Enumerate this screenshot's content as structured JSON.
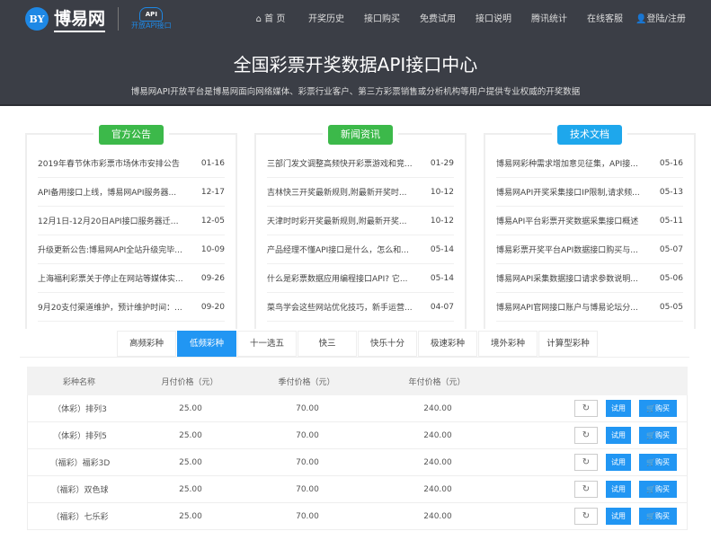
{
  "header": {
    "logo_badge": "BY",
    "logo_name": "博易网",
    "api_badge": "API",
    "api_caption": "开放API接口",
    "nav": [
      "⌂ 首 页",
      "开奖历史",
      "接口购买",
      "免费试用",
      "接口说明",
      "腾讯统计",
      "在线客服",
      "👤登陆/注册"
    ],
    "title": "全国彩票开奖数据API接口中心",
    "subtitle": "博易网API开放平台是博易网面向网络媒体、彩票行业客户、第三方彩票销售或分析机构等用户提供专业权威的开奖数据"
  },
  "panels": [
    {
      "title": "官方公告",
      "color": "#3cb94a",
      "items": [
        [
          "2019年春节休市彩票市场休市安排公告",
          "01-16"
        ],
        [
          "API备用接口上线，博易网API服务器...",
          "12-17"
        ],
        [
          "12月1日-12月20日API接口服务器迁移...",
          "12-05"
        ],
        [
          "升级更新公告:博易网API全站升级完毕...",
          "10-09"
        ],
        [
          "上海福利彩票关于停止在网站等媒体实...",
          "09-26"
        ],
        [
          "9月20支付渠道维护，预计维护时间：...",
          "09-20"
        ]
      ]
    },
    {
      "title": "新闻资讯",
      "color": "#3cb94a",
      "items": [
        [
          "三部门发文调整高频快开彩票游戏和竞...",
          "01-29"
        ],
        [
          "吉林快三开奖最新规则,附最新开奖时...",
          "10-12"
        ],
        [
          "天津时时彩开奖最新规则,附最新开奖...",
          "10-12"
        ],
        [
          "产品经理不懂API接口是什么，怎么和...",
          "05-14"
        ],
        [
          "什么是彩票数据应用编程接口API? 它...",
          "05-14"
        ],
        [
          "菜鸟学会这些网站优化技巧，新手运营...",
          "04-07"
        ]
      ]
    },
    {
      "title": "技术文档",
      "color": "#1ea7ec",
      "items": [
        [
          "博易网彩种需求增加意见征集，API接...",
          "05-16"
        ],
        [
          "博易网API开奖采集接口IP限制,请求频...",
          "05-13"
        ],
        [
          "博易API平台彩票开奖数据采集接口概述",
          "05-11"
        ],
        [
          "博易彩票开奖平台API数据接口购买与...",
          "05-07"
        ],
        [
          "博易网API采集数据接口请求参数说明...",
          "05-06"
        ],
        [
          "博易网API官网接口账户与博易论坛分...",
          "05-05"
        ]
      ]
    }
  ],
  "tabs": [
    "高频彩种",
    "低频彩种",
    "十一选五",
    "快三",
    "快乐十分",
    "极速彩种",
    "境外彩种",
    "计算型彩种"
  ],
  "active_tab": 1,
  "table": {
    "headers": [
      "彩种名称",
      "月付价格（元）",
      "季付价格（元）",
      "年付价格（元）"
    ],
    "refresh": "↻",
    "try": "试用",
    "buy": "🛒购买",
    "rows": [
      [
        "（体彩）排列3",
        "25.00",
        "70.00",
        "240.00"
      ],
      [
        "（体彩）排列5",
        "25.00",
        "70.00",
        "240.00"
      ],
      [
        "（福彩）福彩3D",
        "25.00",
        "70.00",
        "240.00"
      ],
      [
        "（福彩）双色球",
        "25.00",
        "70.00",
        "240.00"
      ],
      [
        "（福彩）七乐彩",
        "25.00",
        "70.00",
        "240.00"
      ]
    ]
  }
}
